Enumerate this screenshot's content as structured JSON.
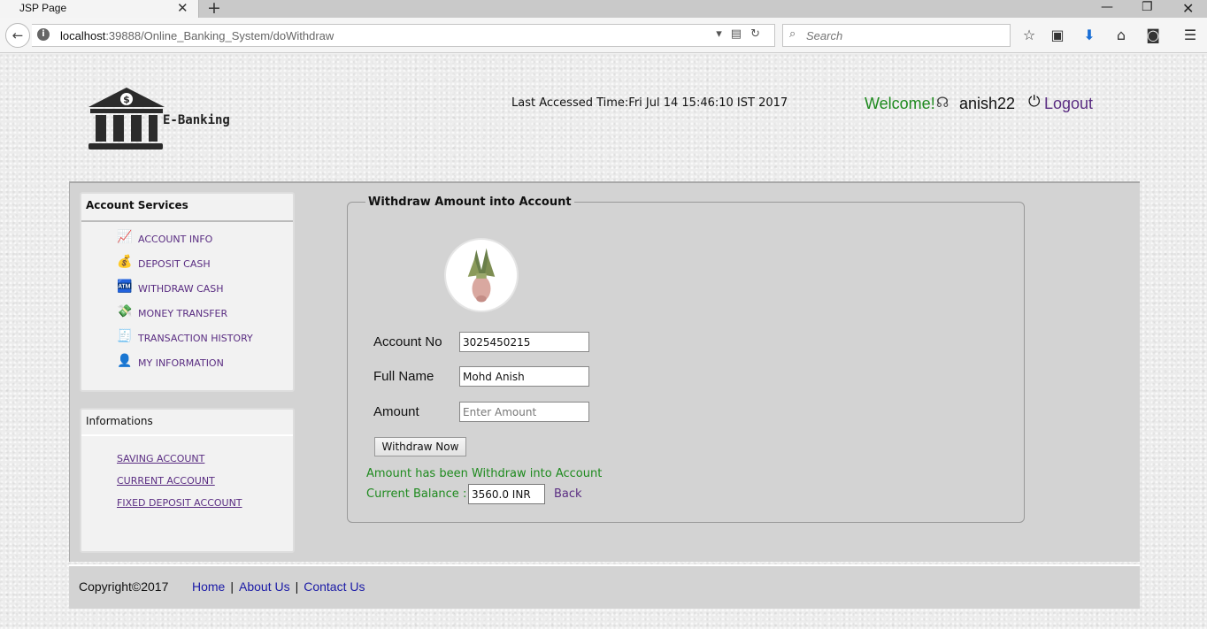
{
  "browser": {
    "tab_title": "JSP Page",
    "url_host": "localhost",
    "url_rest": ":39888/Online_Banking_System/doWithdraw",
    "search_placeholder": "Search"
  },
  "header": {
    "logo_text": "E-Banking",
    "last_accessed": "Last Accessed Time:Fri Jul 14 15:46:10 IST 2017",
    "welcome": "Welcome!",
    "username": "anish22",
    "logout": "Logout"
  },
  "sidebar": {
    "services_title": "Account Services",
    "services": [
      {
        "label": "ACCOUNT INFO",
        "icon": "chart-icon"
      },
      {
        "label": "DEPOSIT CASH",
        "icon": "money-bag-icon"
      },
      {
        "label": "WITHDRAW CASH",
        "icon": "atm-icon"
      },
      {
        "label": "MONEY TRANSFER",
        "icon": "transfer-icon"
      },
      {
        "label": "TRANSACTION HISTORY",
        "icon": "history-icon"
      },
      {
        "label": "MY INFORMATION",
        "icon": "user-icon"
      }
    ],
    "info_title": "Informations",
    "info_links": [
      "SAVING ACCOUNT",
      "CURRENT ACCOUNT",
      "FIXED DEPOSIT ACCOUNT"
    ]
  },
  "form": {
    "legend": "Withdraw Amount into Account",
    "account_no_label": "Account No",
    "account_no_value": "3025450215",
    "full_name_label": "Full Name",
    "full_name_value": "Mohd Anish",
    "amount_label": "Amount",
    "amount_placeholder": "Enter Amount",
    "submit_label": "Withdraw Now",
    "success_message": "Amount has been Withdraw into Account",
    "balance_label": "Current Balance :",
    "balance_value": "3560.0 INR",
    "back_label": "Back"
  },
  "footer": {
    "copyright": "Copyright©2017",
    "links": [
      "Home",
      "About Us",
      "Contact Us"
    ]
  },
  "colors": {
    "link_purple": "#5a2d82",
    "success_green": "#1e8a1e",
    "footer_link_blue": "#1a1aa6"
  }
}
